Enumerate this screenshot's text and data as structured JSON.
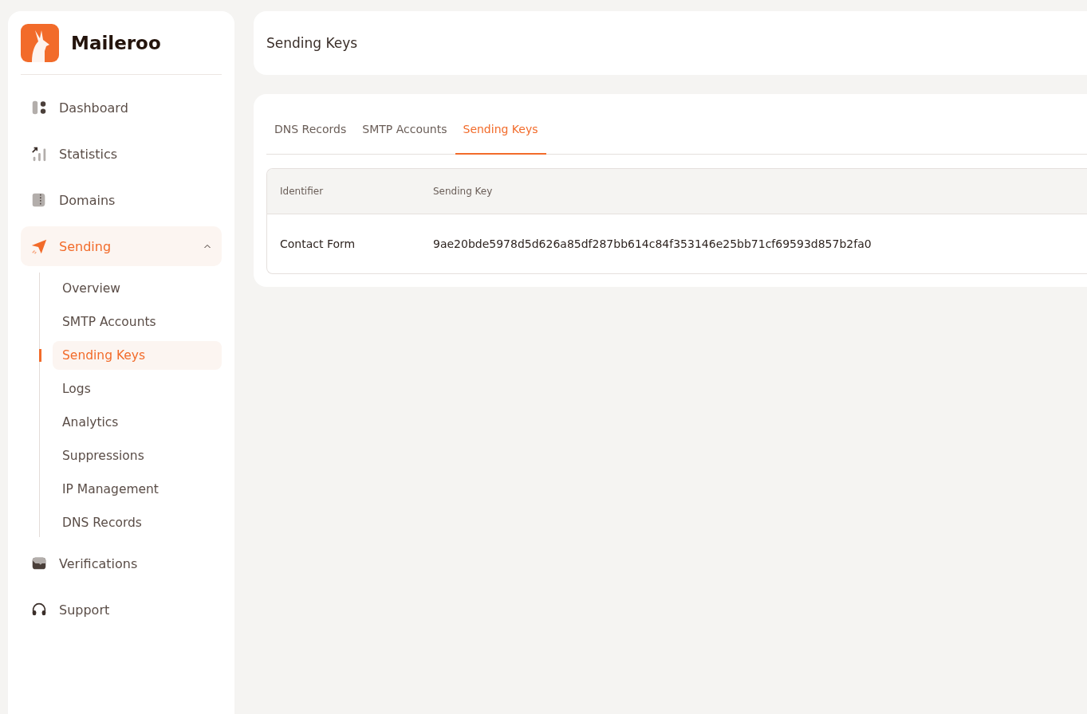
{
  "brand": {
    "name": "Maileroo"
  },
  "sidebar": {
    "items": [
      {
        "label": "Dashboard",
        "selected": false
      },
      {
        "label": "Statistics",
        "selected": false
      },
      {
        "label": "Domains",
        "selected": false
      },
      {
        "label": "Sending",
        "selected": true,
        "expanded": true,
        "children": [
          {
            "label": "Overview",
            "selected": false
          },
          {
            "label": "SMTP Accounts",
            "selected": false
          },
          {
            "label": "Sending Keys",
            "selected": true
          },
          {
            "label": "Logs",
            "selected": false
          },
          {
            "label": "Analytics",
            "selected": false
          },
          {
            "label": "Suppressions",
            "selected": false
          },
          {
            "label": "IP Management",
            "selected": false
          },
          {
            "label": "DNS Records",
            "selected": false
          }
        ]
      },
      {
        "label": "Verifications",
        "selected": false
      },
      {
        "label": "Support",
        "selected": false
      }
    ]
  },
  "header": {
    "title": "Sending Keys"
  },
  "tabs": [
    {
      "label": "DNS Records",
      "selected": false
    },
    {
      "label": "SMTP Accounts",
      "selected": false
    },
    {
      "label": "Sending Keys",
      "selected": true
    }
  ],
  "table": {
    "columns": [
      "Identifier",
      "Sending Key"
    ],
    "rows": [
      [
        "Contact Form",
        "9ae20bde5978d5d626a85df287bb614c84f353146e25bb71cf69593d857b2fa0"
      ]
    ]
  }
}
